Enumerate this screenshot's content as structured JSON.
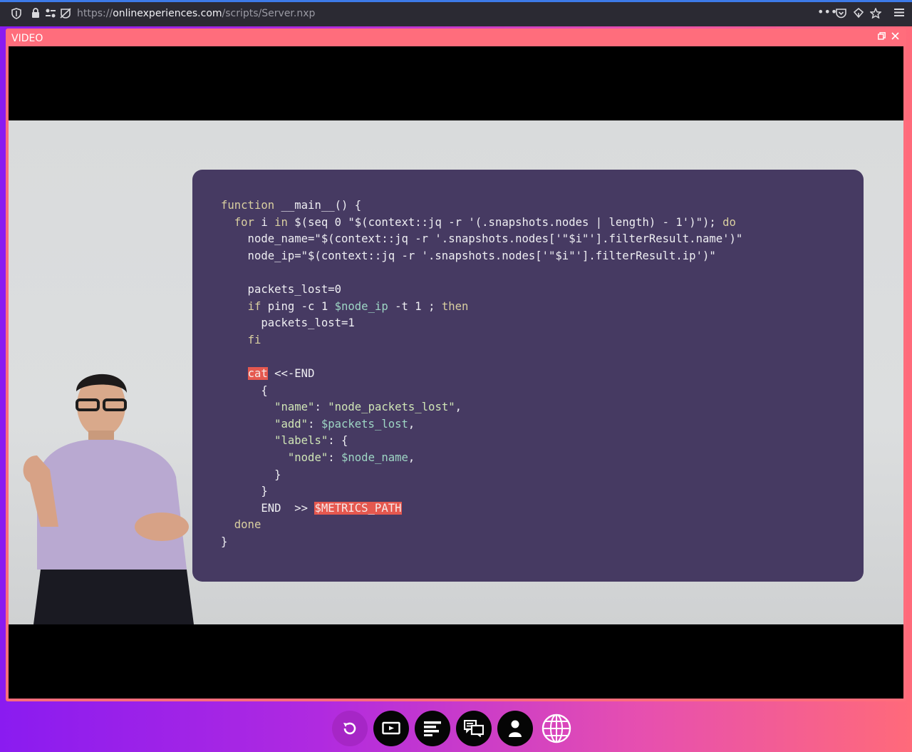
{
  "browser": {
    "url_scheme": "https://",
    "url_host": "onlinexperiences.com",
    "url_path": "/scripts/Server.nxp",
    "icons": [
      "shield-icon",
      "lock-icon",
      "permissions-icon",
      "tracking-icon",
      "more-icon",
      "pocket-icon",
      "screenshot-icon",
      "bookmark-star-icon",
      "menu-icon"
    ]
  },
  "panel": {
    "title": "VIDEO",
    "accent": "#ff6d7c"
  },
  "slide": {
    "background": "#463a62",
    "lines": [
      "function __main__() {",
      "  for i in $(seq 0 \"$(context::jq -r '(.snapshots.nodes | length) - 1')\"); do",
      "    node_name=\"$(context::jq -r '.snapshots.nodes['\"$i\"'].filterResult.name')\"",
      "    node_ip=\"$(context::jq -r '.snapshots.nodes['\"$i\"'].filterResult.ip')\"",
      "",
      "    packets_lost=0",
      "    if ping -c 1 $node_ip -t 1 ; then",
      "      packets_lost=1",
      "    fi",
      "",
      "    cat <<-END",
      "      {",
      "        \"name\": \"node_packets_lost\",",
      "        \"add\": $packets_lost,",
      "        \"labels\": {",
      "          \"node\": $node_name,",
      "        }",
      "      }",
      "      END  >> $METRICS_PATH",
      "  done",
      "}"
    ]
  },
  "controls": [
    {
      "name": "replay-button",
      "icon": "replay-icon"
    },
    {
      "name": "video-button",
      "icon": "video-screen-icon"
    },
    {
      "name": "agenda-button",
      "icon": "list-icon"
    },
    {
      "name": "chat-button",
      "icon": "chat-icon"
    },
    {
      "name": "profile-button",
      "icon": "person-icon"
    },
    {
      "name": "language-button",
      "icon": "globe-icon"
    }
  ]
}
